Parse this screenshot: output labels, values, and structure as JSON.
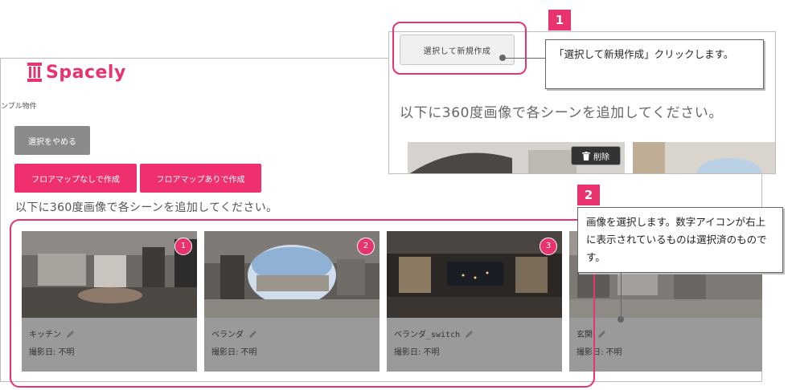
{
  "app": {
    "name": "Spacely"
  },
  "breadcrumb": "ンプル物件",
  "buttons": {
    "stop_select": "選択をやめる",
    "create_without_map": "フロアマップなしで作成",
    "create_with_map": "フロアマップありで作成"
  },
  "instruction": "以下に360度画像で各シーンを追加してください。",
  "scenes": [
    {
      "number": "1",
      "name": "キッチン",
      "date": "撮影日: 不明"
    },
    {
      "number": "2",
      "name": "ベランダ",
      "date": "撮影日: 不明"
    },
    {
      "number": "3",
      "name": "ベランダ_switch",
      "date": "撮影日: 不明"
    },
    {
      "number": "",
      "name": "玄関",
      "date": "撮影日: 不明"
    }
  ],
  "inset": {
    "create_button": "選択して新規作成",
    "instruction": "以下に360度画像で各シーンを追加してください。",
    "delete_label": "削除"
  },
  "steps": [
    {
      "number": "1",
      "text": "「選択して新規作成」クリックします。"
    },
    {
      "number": "2",
      "text": "画像を選択します。数字アイコンが右上に表示されているものは選択済のものです。"
    }
  ],
  "colors": {
    "accent": "#e8336e",
    "button_grey": "#8a8a8a",
    "card_overlay": "#9a9a9a"
  }
}
